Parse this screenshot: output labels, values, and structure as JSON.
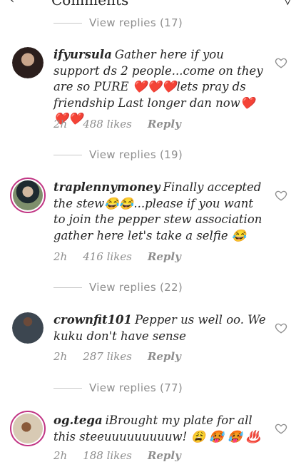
{
  "header": {
    "title": "Comments",
    "back_glyph": "‹",
    "send_glyph": "▽"
  },
  "comments": [
    {
      "view_replies": "View replies (17)",
      "username": "ifyursula",
      "text": "Gather here if you support ds 2 people...come on they are so PURE ❤️❤️❤️lets pray ds friendship Last longer dan now❤️❤️❤️",
      "time": "2h",
      "likes": "488 likes",
      "reply": "Reply",
      "avatar_color": "#3a2a28"
    },
    {
      "view_replies": "View replies (19)",
      "username": "traplennymoney",
      "text": "Finally accepted the stew😂😂...please if you want to join the pepper stew association gather here let's take a selfie 😂",
      "time": "2h",
      "likes": "416 likes",
      "reply": "Reply",
      "avatar_color": "#6b7b5a"
    },
    {
      "view_replies": "View replies (22)",
      "username": "crownfit101",
      "text": "Pepper us well oo. We kuku don't have sense",
      "time": "2h",
      "likes": "287 likes",
      "reply": "Reply",
      "avatar_color": "#4a5560"
    },
    {
      "view_replies": "View replies (77)",
      "username": "og.tega",
      "text": "iBrought my plate for all this steeuuuuuuuuuw! 😩 🥵 🥵 ♨️",
      "time": "2h",
      "likes": "188 likes",
      "reply": "Reply",
      "avatar_color": "#b8a890"
    }
  ]
}
